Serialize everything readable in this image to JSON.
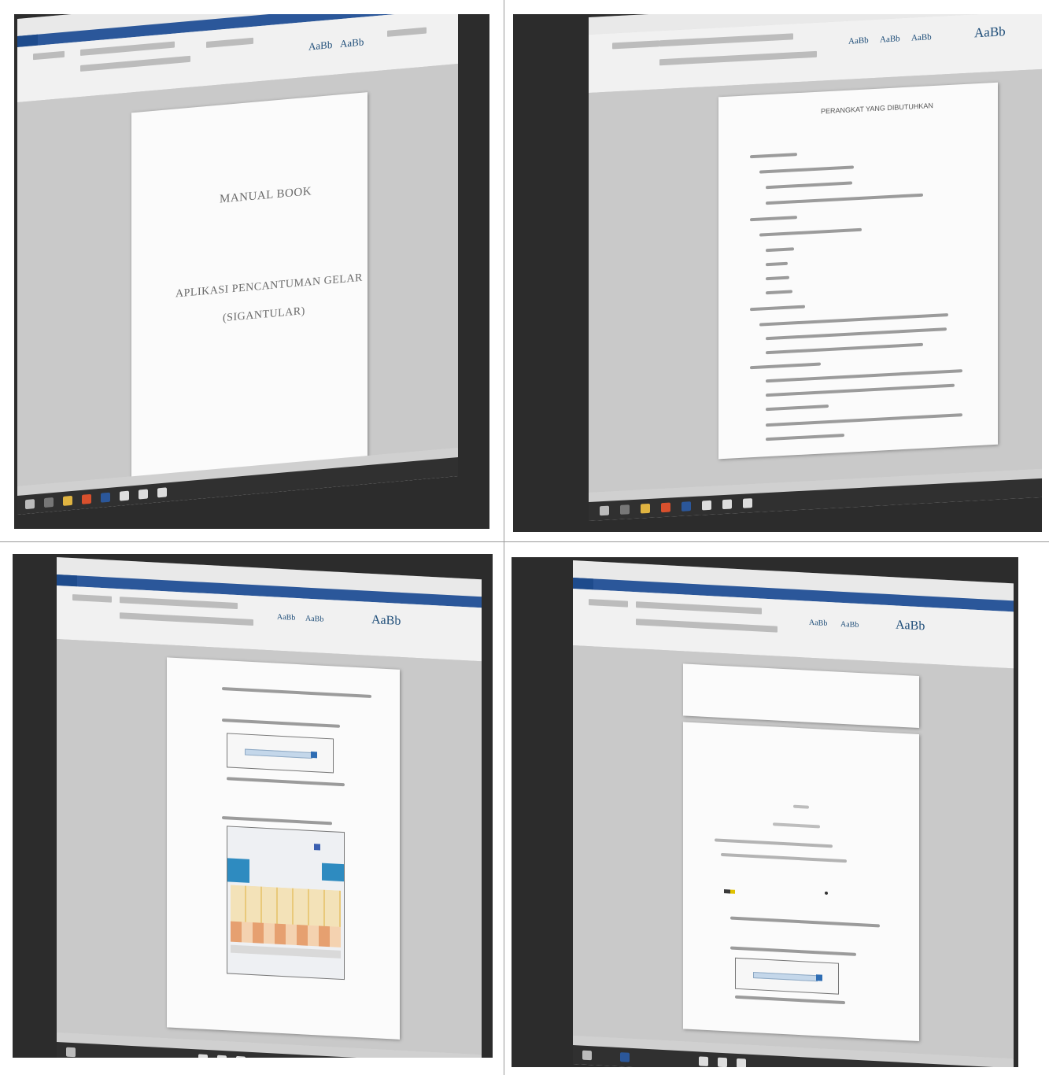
{
  "panels": [
    {
      "id": "top-left",
      "doc_title": "MANUAL BOOK",
      "doc_subtitle_1": "APLIKASI PENCANTUMAN GELAR",
      "doc_subtitle_2": "(SIGANTULAR)"
    },
    {
      "id": "top-right",
      "doc_heading": "PERANGKAT YANG DIBUTUHKAN"
    },
    {
      "id": "bottom-left"
    },
    {
      "id": "bottom-right"
    }
  ],
  "ribbon": {
    "style_sample": "AaBb"
  },
  "colors": {
    "word_blue": "#2b579a",
    "taskbar": "#303030",
    "page": "#fbfbfb"
  }
}
